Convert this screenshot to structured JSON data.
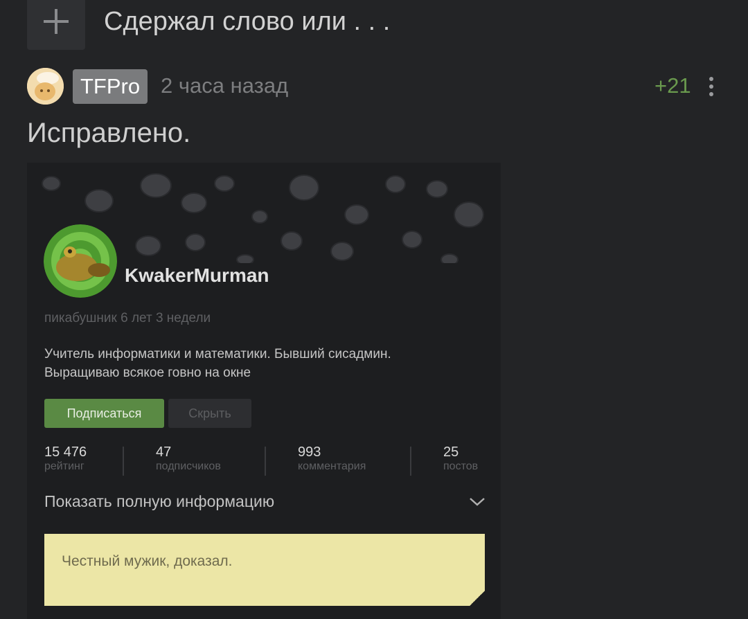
{
  "thread": {
    "title": "Сдержал слово или . . ."
  },
  "comment": {
    "author": "TFPro",
    "time": "2 часа назад",
    "rating": "+21",
    "text": "Исправлено."
  },
  "profile": {
    "username": "KwakerMurman",
    "age": "пикабушник 6 лет 3 недели",
    "bio_line1": "Учитель информатики и математики. Бывший сисадмин.",
    "bio_line2": "Выращиваю всякое говно на окне",
    "subscribe_label": "Подписаться",
    "hide_label": "Скрыть",
    "stats": [
      {
        "value": "15 476",
        "label": "рейтинг"
      },
      {
        "value": "47",
        "label": "подписчиков"
      },
      {
        "value": "993",
        "label": "комментария"
      },
      {
        "value": "25",
        "label": "постов"
      }
    ],
    "show_info_label": "Показать полную информацию",
    "note": "Честный мужик, доказал."
  },
  "colors": {
    "background": "#232426",
    "rating_green": "#6a9a4e",
    "subscribe_green": "#5a8a44",
    "note_yellow": "#ece6a6"
  },
  "icons": [
    "plus-icon",
    "more-vertical-icon",
    "chevron-down-icon"
  ]
}
